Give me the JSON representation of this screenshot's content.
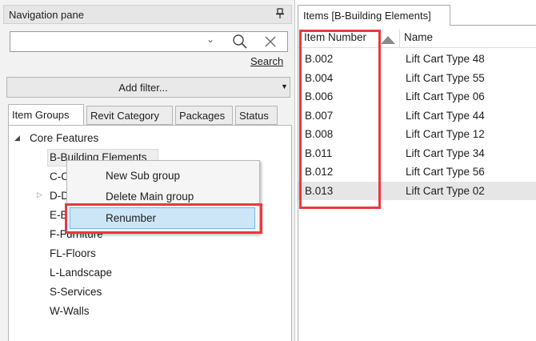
{
  "nav": {
    "title": "Navigation pane",
    "search_value": "",
    "search_link": "Search",
    "filter_label": "Add filter...",
    "tabs": [
      {
        "label": "Item Groups"
      },
      {
        "label": "Revit Category"
      },
      {
        "label": "Packages"
      },
      {
        "label": "Status"
      }
    ],
    "tree": {
      "root": "Core Features",
      "groups": [
        {
          "label": "B-Building Elements"
        },
        {
          "label": "C-C"
        },
        {
          "label": "D-D"
        },
        {
          "label": "E-E"
        },
        {
          "label": "F-Furniture"
        },
        {
          "label": "FL-Floors"
        },
        {
          "label": "L-Landscape"
        },
        {
          "label": "S-Services"
        },
        {
          "label": "W-Walls"
        }
      ]
    }
  },
  "context_menu": {
    "items": [
      {
        "label": "New Sub group"
      },
      {
        "label": "Delete Main group"
      },
      {
        "label": "Renumber"
      }
    ]
  },
  "items": {
    "tab_label": "Items [B-Building Elements]",
    "columns": {
      "item_number": "Item Number",
      "name": "Name"
    },
    "rows": [
      {
        "num": "B.002",
        "name": "Lift Cart Type 48"
      },
      {
        "num": "B.004",
        "name": "Lift Cart Type 55"
      },
      {
        "num": "B.006",
        "name": "Lift Cart Type 06"
      },
      {
        "num": "B.007",
        "name": "Lift Cart Type 44"
      },
      {
        "num": "B.008",
        "name": "Lift Cart Type 12"
      },
      {
        "num": "B.011",
        "name": "Lift Cart Type 34"
      },
      {
        "num": "B.012",
        "name": "Lift Cart Type 56"
      },
      {
        "num": "B.013",
        "name": "Lift Cart Type 02"
      }
    ]
  },
  "colors": {
    "highlight_border": "#e8393f",
    "menu_hover": "#cde6f7",
    "selected_row": "#e6e6e6"
  }
}
